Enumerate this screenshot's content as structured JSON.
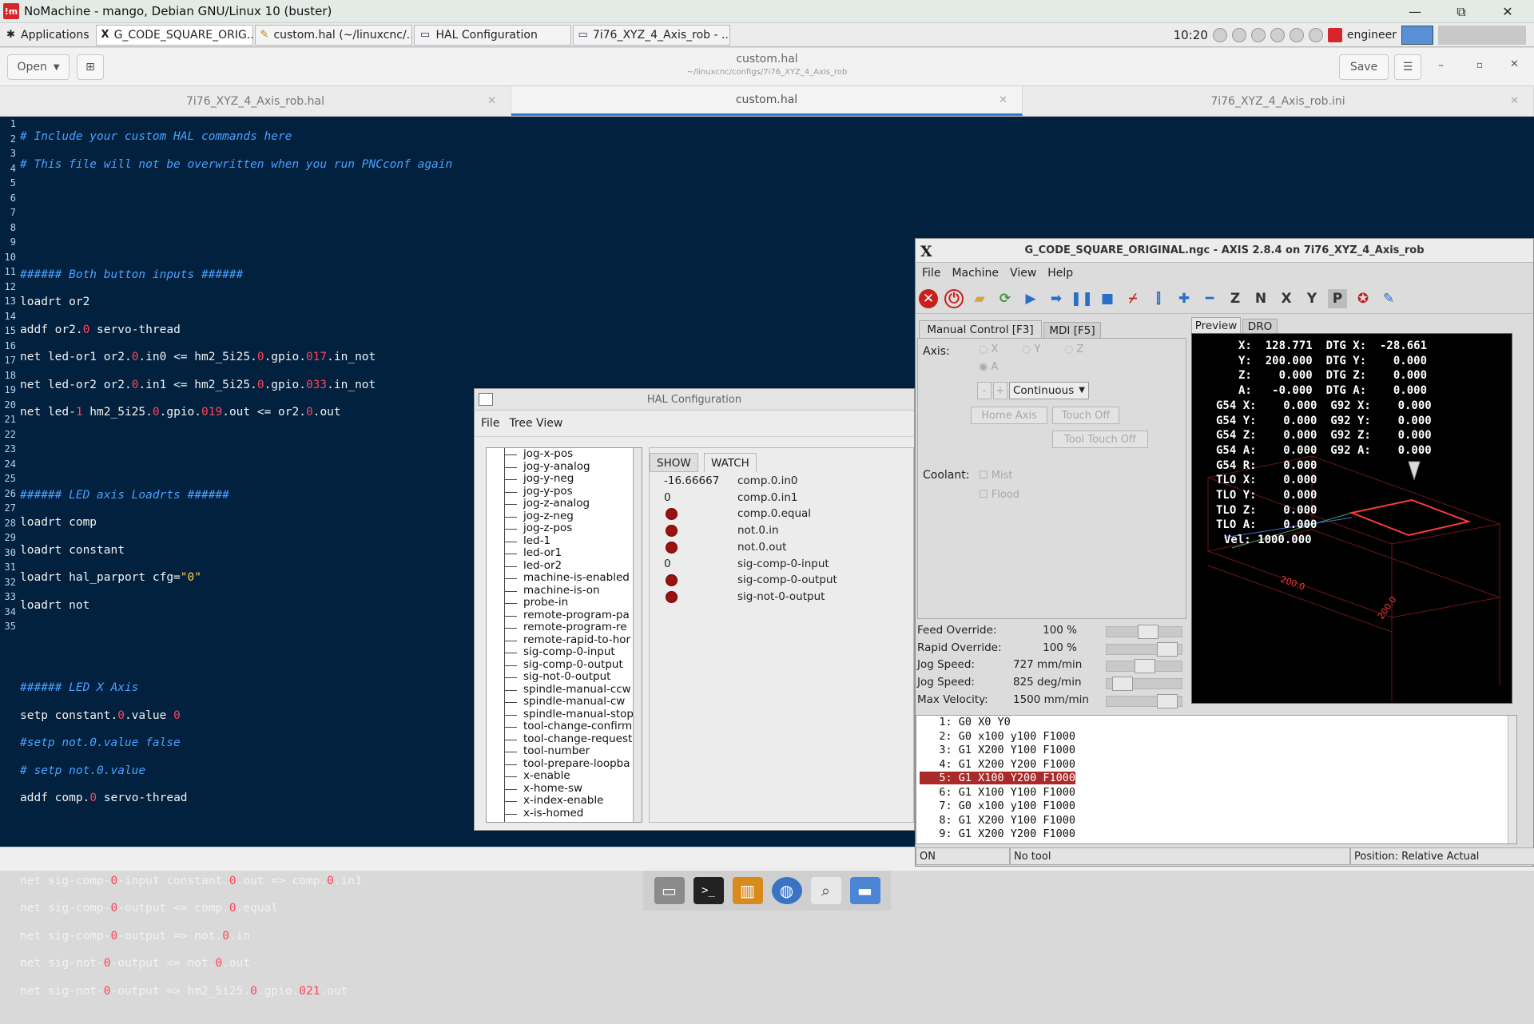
{
  "nomachine": {
    "title": "NoMachine - mango, Debian GNU/Linux 10 (buster)",
    "logo": "!m",
    "minimize": "—",
    "restore": "⧉",
    "close": "✕"
  },
  "taskbar": {
    "apps_label": "Applications",
    "tasks": [
      {
        "label": "G_CODE_SQUARE_ORIG...",
        "icon": "X"
      },
      {
        "label": "custom.hal (~/linuxcnc/...",
        "icon": "✎"
      },
      {
        "label": "HAL Configuration",
        "icon": "▭"
      },
      {
        "label": "7i76_XYZ_4_Axis_rob - ...",
        "icon": "▭"
      }
    ],
    "clock": "10:20",
    "user": "engineer"
  },
  "gedit": {
    "open_label": "Open",
    "title": "custom.hal",
    "subtitle": "~/linuxcnc/configs/7i76_XYZ_4_Axis_rob",
    "save_label": "Save",
    "tabs": [
      {
        "label": "7i76_XYZ_4_Axis_rob.hal"
      },
      {
        "label": "custom.hal"
      },
      {
        "label": "7i76_XYZ_4_Axis_rob.ini"
      }
    ],
    "line_numbers": [
      "1",
      "2",
      "3",
      "4",
      "5",
      "6",
      "7",
      "8",
      "9",
      "10",
      "11",
      "12",
      "13",
      "14",
      "15",
      "16",
      "17",
      "18",
      "19",
      "20",
      "21",
      "22",
      "23",
      "24",
      "25",
      "26",
      "27",
      "28",
      "29",
      "30",
      "31",
      "32",
      "33",
      "34",
      "35"
    ]
  },
  "hal": {
    "title": "HAL Configuration",
    "menu": [
      "File",
      "Tree View"
    ],
    "tree": [
      "jog-x-pos",
      "jog-y-analog",
      "jog-y-neg",
      "jog-y-pos",
      "jog-z-analog",
      "jog-z-neg",
      "jog-z-pos",
      "led-1",
      "led-or1",
      "led-or2",
      "machine-is-enabled",
      "machine-is-on",
      "probe-in",
      "remote-program-pa",
      "remote-program-re",
      "remote-rapid-to-hor",
      "sig-comp-0-input",
      "sig-comp-0-output",
      "sig-not-0-output",
      "spindle-manual-ccw",
      "spindle-manual-cw",
      "spindle-manual-stop",
      "tool-change-confirm",
      "tool-change-request",
      "tool-number",
      "tool-prepare-loopba",
      "x-enable",
      "x-home-sw",
      "x-index-enable",
      "x-is-homed"
    ],
    "tabs": {
      "show": "SHOW",
      "watch": "WATCH"
    },
    "watch": [
      {
        "value": "-16.66667",
        "name": "comp.0.in0"
      },
      {
        "value": "0",
        "name": "comp.0.in1"
      },
      {
        "value": "",
        "name": "comp.0.equal"
      },
      {
        "value": "",
        "name": "not.0.in"
      },
      {
        "value": "",
        "name": "not.0.out"
      },
      {
        "value": "0",
        "name": "sig-comp-0-input"
      },
      {
        "value": "",
        "name": "sig-comp-0-output"
      },
      {
        "value": "",
        "name": "sig-not-0-output"
      }
    ]
  },
  "axis": {
    "title": "G_CODE_SQUARE_ORIGINAL.ngc - AXIS 2.8.4 on 7i76_XYZ_4_Axis_rob",
    "menu": [
      "File",
      "Machine",
      "View",
      "Help"
    ],
    "tabs": {
      "manual": "Manual Control [F3]",
      "mdi": "MDI [F5]",
      "preview": "Preview",
      "dro": "DRO"
    },
    "axis_label": "Axis:",
    "radios": [
      "X",
      "Y",
      "Z",
      "A"
    ],
    "minus": "-",
    "plus": "+",
    "jog_mode": "Continuous",
    "home_axis": "Home Axis",
    "touch_off": "Touch Off",
    "tool_touch_off": "Tool Touch Off",
    "coolant_label": "Coolant:",
    "mist": "Mist",
    "flood": "Flood",
    "overrides": [
      {
        "label": "Feed Override:",
        "value": "100 %",
        "level": 0.55
      },
      {
        "label": "Rapid Override:",
        "value": "100 %",
        "level": 0.9
      },
      {
        "label": "Jog Speed:",
        "value": "727 mm/min",
        "level": 0.5
      },
      {
        "label": "Jog Speed:",
        "value": "825 deg/min",
        "level": 0.1
      },
      {
        "label": "Max Velocity:",
        "value": "1500 mm/min",
        "level": 0.9
      }
    ],
    "dro_lines": [
      "X:  128.771  DTG X:  -28.661",
      "Y:  200.000  DTG Y:    0.000",
      "Z:    0.000  DTG Z:    0.000",
      "A:   -0.000  DTG A:    0.000",
      "G54 X:    0.000  G92 X:    0.000",
      "G54 Y:    0.000  G92 Y:    0.000",
      "G54 Z:    0.000  G92 Z:    0.000",
      "G54 A:    0.000  G92 A:    0.000",
      "G54 R:    0.000",
      "TLO X:    0.000",
      "TLO Y:    0.000",
      "TLO Z:    0.000",
      "TLO A:    0.000",
      "Vel: 1000.000"
    ],
    "preview_labels": {
      "x_dim": "200.0",
      "y_dim": "200.0"
    },
    "gcode": [
      "   1: G0 X0 Y0",
      "   2: G0 x100 y100 F1000",
      "   3: G1 X200 Y100 F1000",
      "   4: G1 X200 Y200 F1000",
      "   5: G1 X100 Y200 F1000",
      "   6: G1 X100 Y100 F1000",
      "   7: G0 x100 y100 F1000",
      "   8: G1 X200 Y100 F1000",
      "   9: G1 X200 Y200 F1000"
    ],
    "status": {
      "state": "ON",
      "tool": "No tool",
      "position": "Position: Relative Actual"
    }
  },
  "colors": {
    "editor_bg": "#02213f",
    "comment": "#4aa1ff",
    "number": "#ff4458",
    "string": "#ffd24b",
    "accent": "#2f7ad4",
    "led": "#9b1212",
    "gcode_highlight": "#aa2a2a"
  }
}
